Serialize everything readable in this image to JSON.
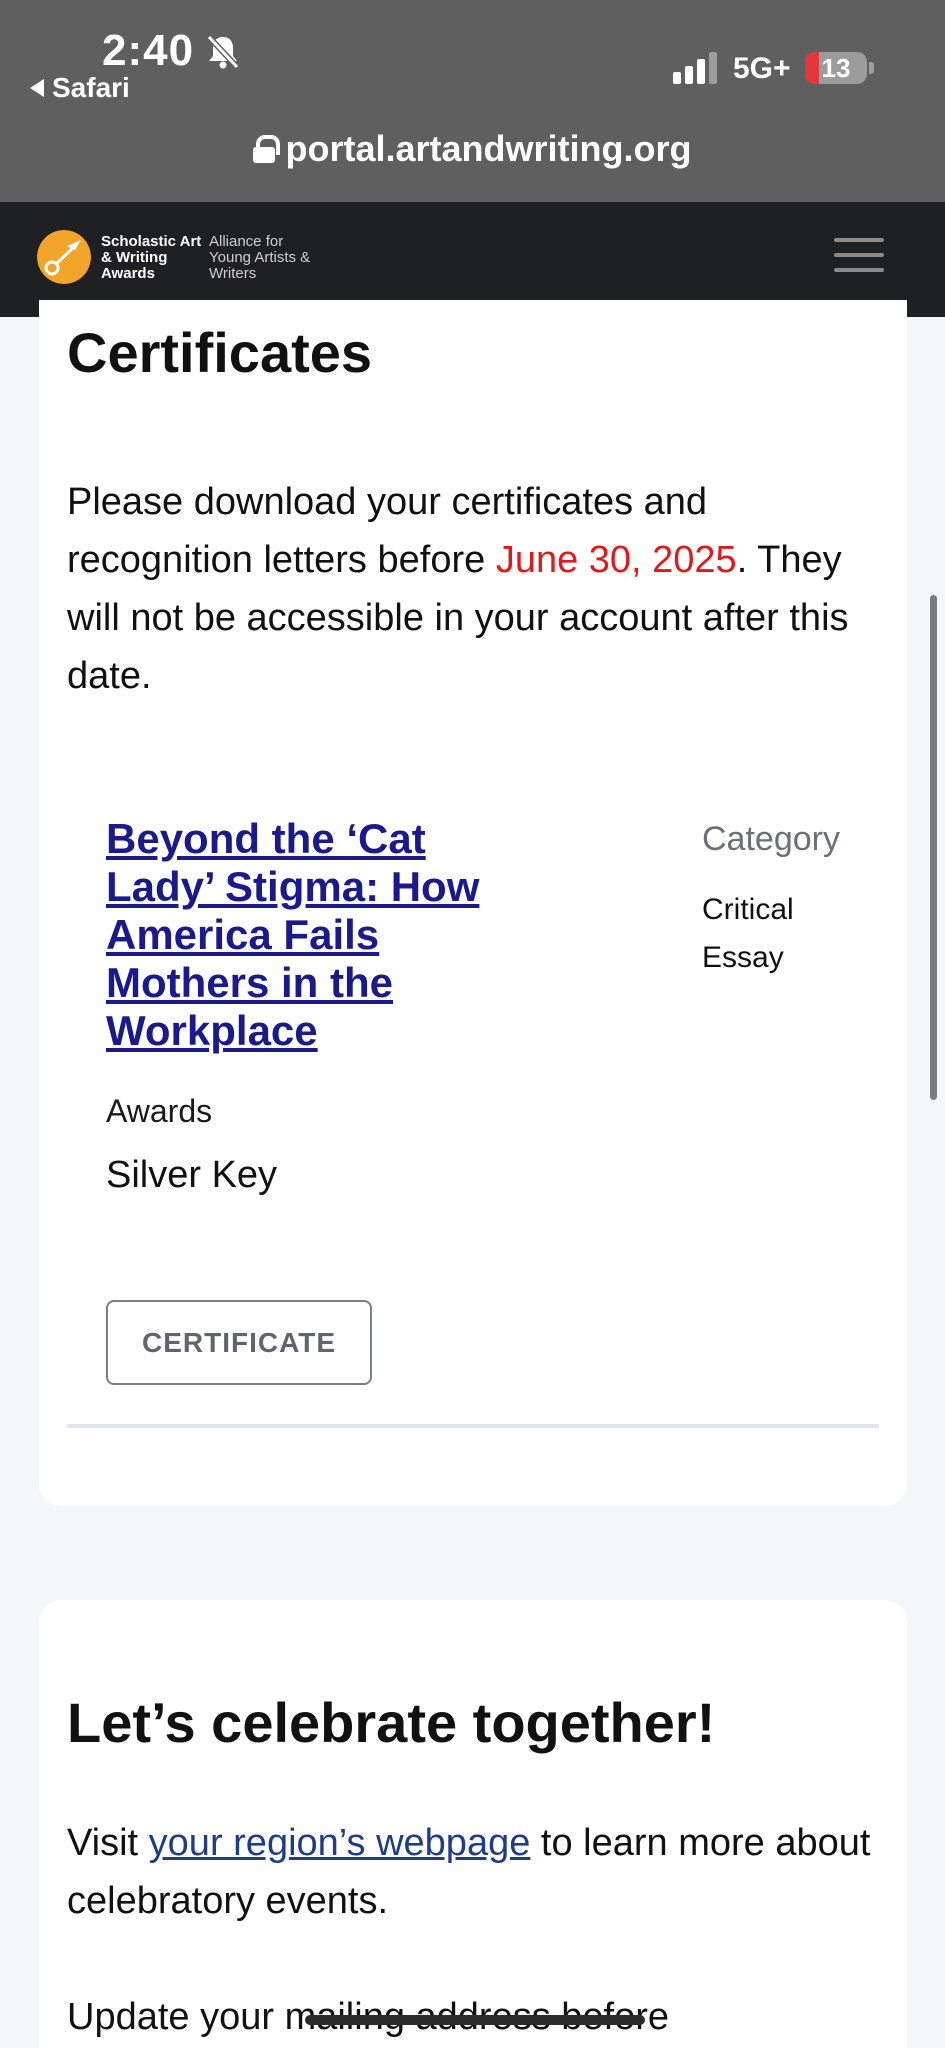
{
  "status_bar": {
    "time": "2:40",
    "back_app": "Safari",
    "network": "5G+",
    "battery": "13",
    "url": "portal.artandwriting.org"
  },
  "site_header": {
    "logo_main": "Scholastic Art & Writing Awards",
    "logo_sub": "Alliance for Young Artists & Writers"
  },
  "certificates": {
    "heading": "Certificates",
    "notice_before": "Please download your certificates and recognition letters before ",
    "deadline": "June 30, 2025",
    "notice_after": ". They will not be accessible in your account after this date.",
    "entry": {
      "title": "Beyond the ‘Cat Lady’ Stigma: How America Fails Mothers in the Workplace",
      "category_label": "Category",
      "category_value": "Critical Essay",
      "awards_label": "Awards",
      "awards_value": "Silver Key",
      "certificate_button": "CERTIFICATE"
    }
  },
  "celebrate": {
    "heading": "Let’s celebrate together!",
    "visit_before": "Visit ",
    "visit_link": "your region’s webpage",
    "visit_after": " to learn more about celebratory events.",
    "update_text": "Update your mailing address before"
  },
  "colors": {
    "deadline": "#e01a1a",
    "link": "#1a1a8c",
    "logo_accent": "#f3a52b"
  }
}
